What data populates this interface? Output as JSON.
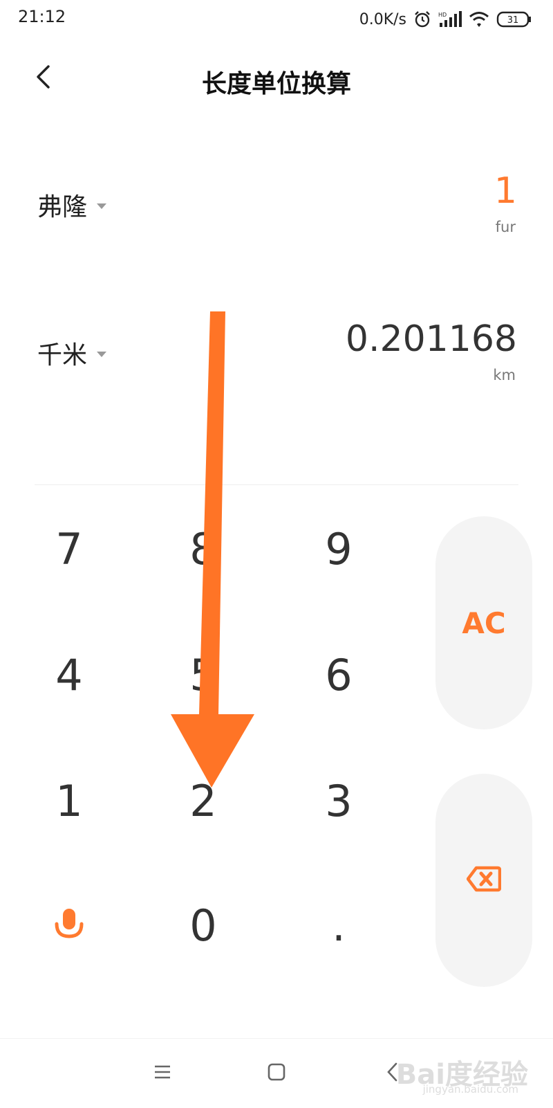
{
  "status_bar": {
    "time": "21:12",
    "net_speed": "0.0K/s",
    "battery": "31",
    "icons": [
      "alarm-icon",
      "hd-signal-icon",
      "wifi-icon",
      "battery-icon"
    ]
  },
  "header": {
    "title": "长度单位换算",
    "back_icon": "back-chevron-icon"
  },
  "from_unit": {
    "name": "弗隆",
    "value": "1",
    "abbr": "fur"
  },
  "to_unit": {
    "name": "千米",
    "value": "0.201168",
    "abbr": "km"
  },
  "keypad": {
    "keys": [
      "7",
      "8",
      "9",
      "4",
      "5",
      "6",
      "1",
      "2",
      "3",
      "0",
      "."
    ],
    "clear_label": "AC",
    "mic_icon": "microphone-icon",
    "backspace_icon": "backspace-icon"
  },
  "nav": {
    "icons": [
      "menu-icon",
      "home-icon",
      "back-icon"
    ]
  },
  "watermark": {
    "text": "Bai度经验",
    "sub": "jingyan.baidu.com"
  },
  "colors": {
    "accent": "#ff7a2f",
    "arrow": "#ff7426",
    "text": "#222222",
    "button_bg": "#f4f4f4"
  }
}
